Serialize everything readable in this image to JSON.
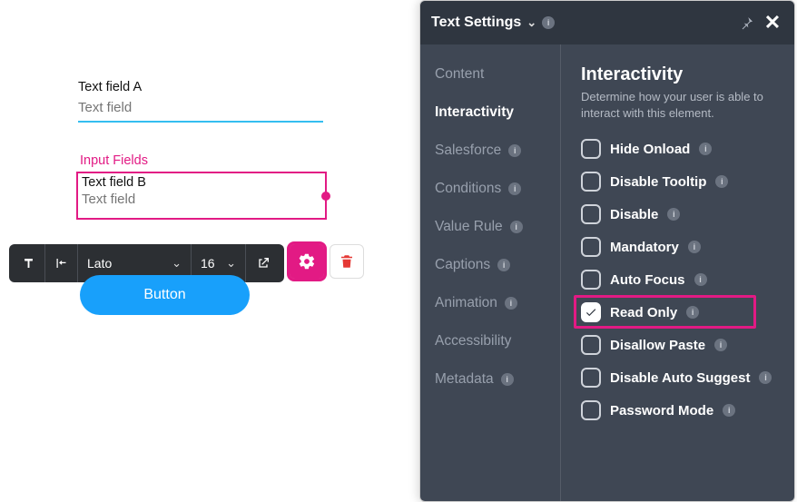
{
  "canvas": {
    "field_a": {
      "label": "Text field A",
      "placeholder": "Text field"
    },
    "section_label": "Input Fields",
    "field_b": {
      "label": "Text field B",
      "placeholder": "Text field"
    },
    "button_label": "Button"
  },
  "toolbar": {
    "font": "Lato",
    "font_size": "16"
  },
  "panel": {
    "title": "Text Settings",
    "nav": [
      {
        "label": "Content",
        "has_info": false
      },
      {
        "label": "Interactivity",
        "has_info": false,
        "active": true
      },
      {
        "label": "Salesforce",
        "has_info": true
      },
      {
        "label": "Conditions",
        "has_info": true
      },
      {
        "label": "Value Rule",
        "has_info": true
      },
      {
        "label": "Captions",
        "has_info": true
      },
      {
        "label": "Animation",
        "has_info": true
      },
      {
        "label": "Accessibility",
        "has_info": false
      },
      {
        "label": "Metadata",
        "has_info": true
      }
    ],
    "section": {
      "title": "Interactivity",
      "desc": "Determine how your user is able to interact with this element."
    },
    "options": [
      {
        "label": "Hide Onload",
        "checked": false
      },
      {
        "label": "Disable Tooltip",
        "checked": false
      },
      {
        "label": "Disable",
        "checked": false
      },
      {
        "label": "Mandatory",
        "checked": false
      },
      {
        "label": "Auto Focus",
        "checked": false
      },
      {
        "label": "Read Only",
        "checked": true,
        "highlight": true
      },
      {
        "label": "Disallow Paste",
        "checked": false
      },
      {
        "label": "Disable Auto Suggest",
        "checked": false
      },
      {
        "label": "Password Mode",
        "checked": false
      }
    ]
  }
}
